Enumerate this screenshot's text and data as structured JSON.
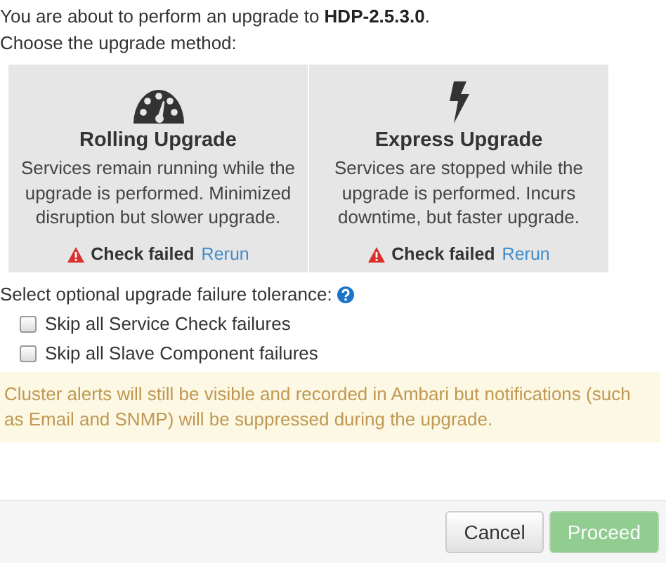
{
  "intro": "You are about to perform an upgrade to **HDP-2.5.3.0**.",
  "prompt": "Choose the upgrade method:",
  "methods": [
    {
      "kind": "rolling",
      "title": "Rolling Upgrade",
      "description": "Services remain running while the upgrade is performed. Minimized disruption but slower upgrade.",
      "status": "Check failed",
      "action": "Rerun"
    },
    {
      "kind": "express",
      "title": "Express Upgrade",
      "description": "Services are stopped while the upgrade is performed. Incurs downtime, but faster upgrade.",
      "status": "Check failed",
      "action": "Rerun"
    }
  ],
  "tolerance_label": "Select optional upgrade failure tolerance:",
  "options": [
    {
      "label": "Skip all Service Check failures",
      "checked": false
    },
    {
      "label": "Skip all Slave Component failures",
      "checked": false
    }
  ],
  "alert": "Cluster alerts will still be visible and recorded in Ambari but notifications (such as Email and SNMP) will be suppressed during the upgrade.",
  "buttons": [
    {
      "label": "Cancel",
      "kind": "default",
      "disabled": false
    },
    {
      "label": "Proceed",
      "kind": "primary",
      "disabled": true
    }
  ]
}
